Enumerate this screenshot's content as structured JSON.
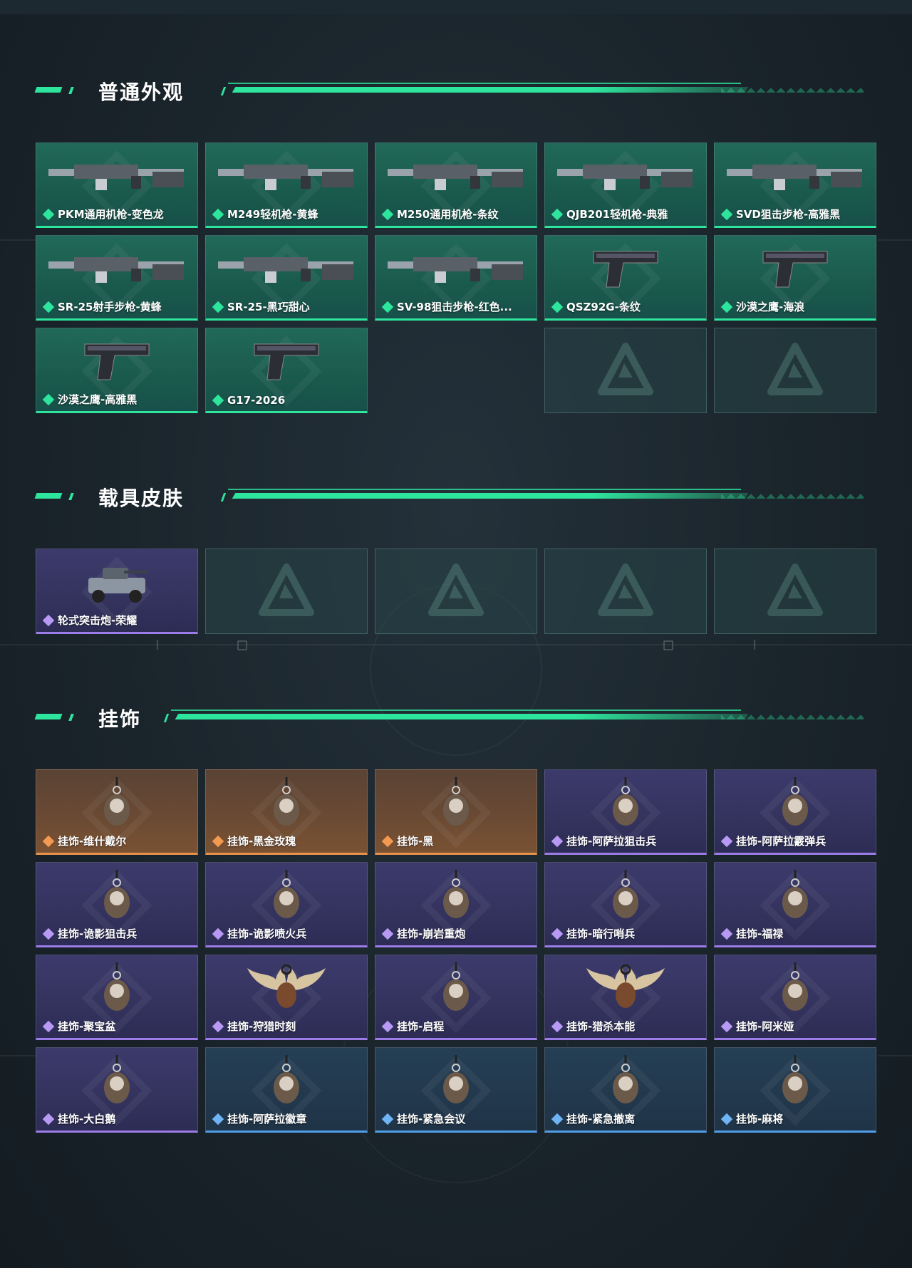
{
  "colors": {
    "accent": "#2ee59d",
    "rarity_green": "#2ee59d",
    "rarity_purple": "#9b7ce8",
    "rarity_orange": "#e8924a",
    "rarity_blue": "#4f9ee8"
  },
  "sections": {
    "weapons": {
      "title": "普通外观",
      "items": [
        {
          "label": "PKM通用机枪-变色龙",
          "rarity": "green",
          "icon": "machine-gun-icon"
        },
        {
          "label": "M249轻机枪-黄蜂",
          "rarity": "green",
          "icon": "machine-gun-icon"
        },
        {
          "label": "M250通用机枪-条纹",
          "rarity": "green",
          "icon": "machine-gun-icon"
        },
        {
          "label": "QJB201轻机枪-典雅",
          "rarity": "green",
          "icon": "machine-gun-icon"
        },
        {
          "label": "SVD狙击步枪-高雅黑",
          "rarity": "green",
          "icon": "sniper-rifle-icon"
        },
        {
          "label": "SR-25射手步枪-黄蜂",
          "rarity": "green",
          "icon": "rifle-icon"
        },
        {
          "label": "SR-25-黑巧甜心",
          "rarity": "green",
          "icon": "rifle-icon"
        },
        {
          "label": "SV-98狙击步枪-红色...",
          "rarity": "green",
          "icon": "sniper-rifle-icon"
        },
        {
          "label": "QSZ92G-条纹",
          "rarity": "green",
          "icon": "pistol-icon"
        },
        {
          "label": "沙漠之鹰-海浪",
          "rarity": "green",
          "icon": "pistol-icon"
        },
        {
          "label": "沙漠之鹰-高雅黑",
          "rarity": "green",
          "icon": "pistol-icon"
        },
        {
          "label": "G17-2026",
          "rarity": "green",
          "icon": "pistol-icon"
        }
      ],
      "empty_slots": 3
    },
    "vehicles": {
      "title": "载具皮肤",
      "items": [
        {
          "label": "轮式突击炮-荣耀",
          "rarity": "purple",
          "icon": "vehicle-icon"
        }
      ],
      "empty_slots": 4
    },
    "charms": {
      "title": "挂饰",
      "items": [
        {
          "label": "挂饰-维什戴尔",
          "rarity": "orange",
          "icon": "charm-icon"
        },
        {
          "label": "挂饰-黑金玫瑰",
          "rarity": "orange",
          "icon": "charm-icon"
        },
        {
          "label": "挂饰-黑",
          "rarity": "orange",
          "icon": "charm-icon"
        },
        {
          "label": "挂饰-阿萨拉狙击兵",
          "rarity": "purple",
          "icon": "charm-icon"
        },
        {
          "label": "挂饰-阿萨拉霰弹兵",
          "rarity": "purple",
          "icon": "charm-icon"
        },
        {
          "label": "挂饰-诡影狙击兵",
          "rarity": "purple",
          "icon": "charm-icon"
        },
        {
          "label": "挂饰-诡影喷火兵",
          "rarity": "purple",
          "icon": "charm-icon"
        },
        {
          "label": "挂饰-崩岩重炮",
          "rarity": "purple",
          "icon": "charm-icon"
        },
        {
          "label": "挂饰-暗行哨兵",
          "rarity": "purple",
          "icon": "charm-icon"
        },
        {
          "label": "挂饰-福禄",
          "rarity": "purple",
          "icon": "charm-icon"
        },
        {
          "label": "挂饰-聚宝盆",
          "rarity": "purple",
          "icon": "charm-icon"
        },
        {
          "label": "挂饰-狩猎时刻",
          "rarity": "purple",
          "icon": "antler-charm-icon"
        },
        {
          "label": "挂饰-启程",
          "rarity": "purple",
          "icon": "charm-icon"
        },
        {
          "label": "挂饰-猎杀本能",
          "rarity": "purple",
          "icon": "antler-charm-icon"
        },
        {
          "label": "挂饰-阿米娅",
          "rarity": "purple",
          "icon": "charm-icon"
        },
        {
          "label": "挂饰-大白鹅",
          "rarity": "purple",
          "icon": "charm-icon"
        },
        {
          "label": "挂饰-阿萨拉徽章",
          "rarity": "blue",
          "icon": "charm-icon"
        },
        {
          "label": "挂饰-紧急会议",
          "rarity": "blue",
          "icon": "charm-icon"
        },
        {
          "label": "挂饰-紧急撤离",
          "rarity": "blue",
          "icon": "charm-icon"
        },
        {
          "label": "挂饰-麻将",
          "rarity": "blue",
          "icon": "charm-icon"
        }
      ],
      "empty_slots": 0
    }
  }
}
